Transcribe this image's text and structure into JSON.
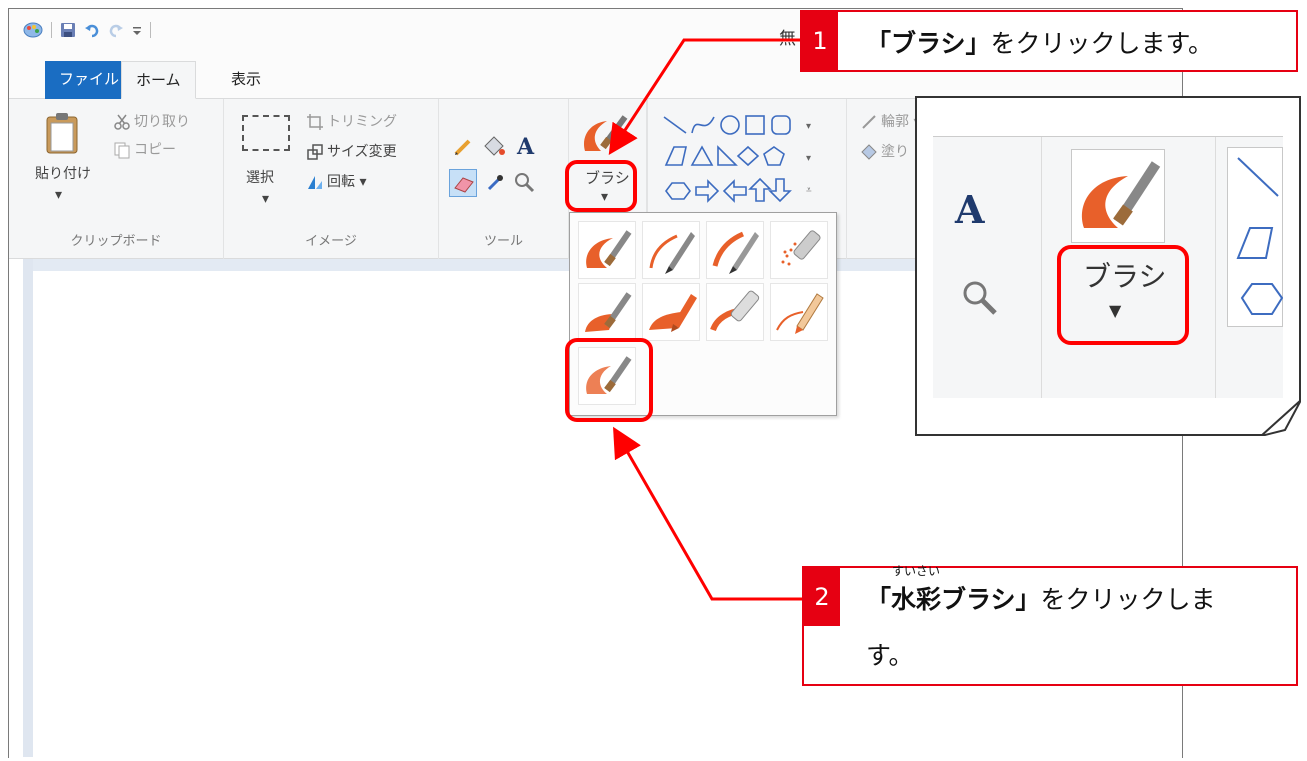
{
  "window": {
    "title": "無",
    "tabs": {
      "file": "ファイル",
      "home": "ホーム",
      "view": "表示"
    }
  },
  "ribbon": {
    "clipboard": {
      "paste": "貼り付け",
      "cut": "切り取り",
      "copy": "コピー",
      "label": "クリップボード"
    },
    "image": {
      "select": "選択",
      "crop": "トリミング",
      "resize": "サイズ変更",
      "rotate": "回転",
      "label": "イメージ"
    },
    "tools": {
      "label": "ツール"
    },
    "brush": {
      "label": "ブラシ"
    },
    "shapes": {
      "outline": "輪郭",
      "fill": "塗り"
    }
  },
  "zoom": {
    "brush_label": "ブラシ"
  },
  "callouts": {
    "step1": {
      "number": "1",
      "bold": "「ブラシ」",
      "text": "をクリックします。"
    },
    "step2": {
      "number": "2",
      "bold": "「水彩ブラシ」",
      "text_line1": "をクリックしま",
      "text_line2": "す。",
      "ruby": "すいさい"
    }
  },
  "colors": {
    "accent_red": "#e60012",
    "highlight_red": "#ff0000",
    "file_tab_blue": "#1a6dc2",
    "brush_orange": "#e8602a"
  }
}
